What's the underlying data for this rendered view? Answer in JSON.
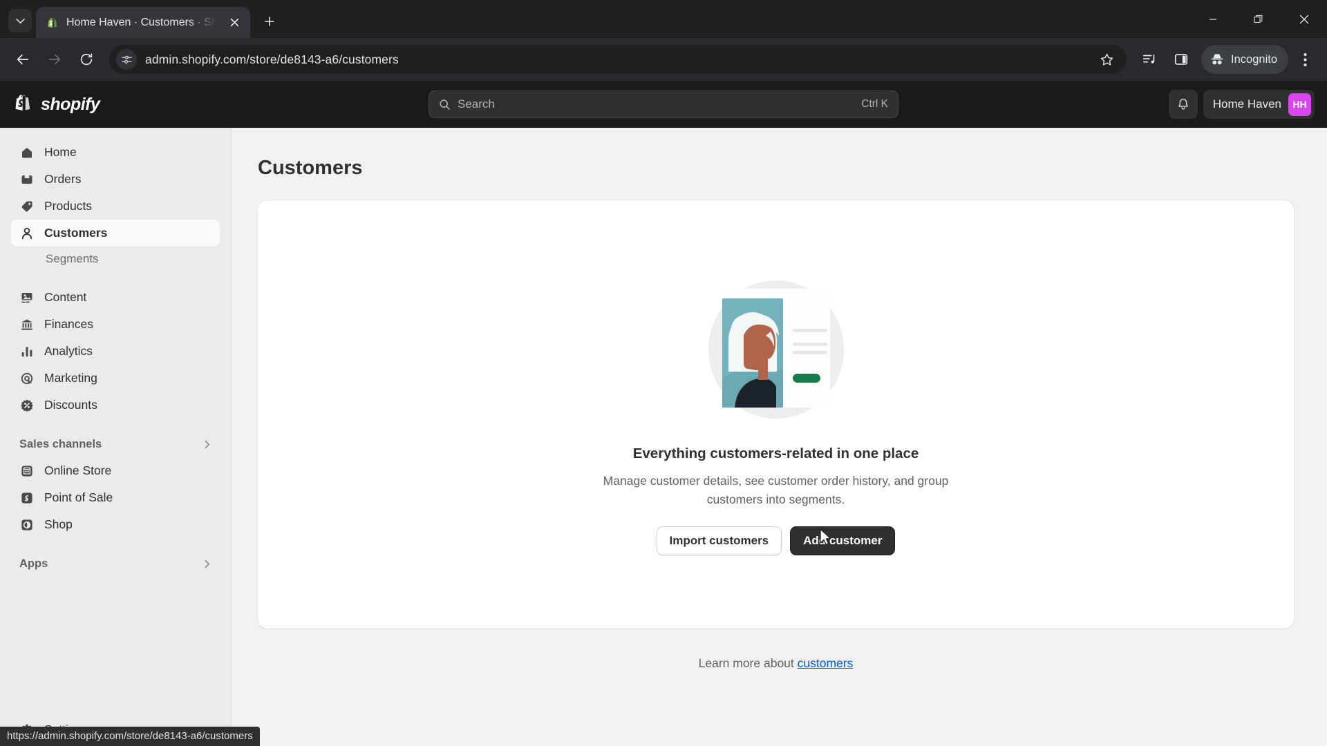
{
  "browser": {
    "tab": {
      "title": "Home Haven · Customers · Sho",
      "favicon": "shopify-favicon"
    },
    "new_tab_label": "+",
    "url": "admin.shopify.com/store/de8143-a6/customers",
    "toolbar_icons": [
      "back-icon",
      "forward-icon",
      "reload-icon",
      "site-settings-icon",
      "bookmark-star-icon",
      "media-control-icon",
      "side-panel-icon",
      "browser-menu-icon"
    ],
    "profile_label": "Incognito",
    "window_controls": [
      "minimize",
      "restore",
      "close"
    ],
    "status_url": "https://admin.shopify.com/store/de8143-a6/customers"
  },
  "topbar": {
    "brand": "shopify",
    "search": {
      "placeholder": "Search",
      "shortcut": "Ctrl K"
    },
    "notifications_icon": "bell-icon",
    "store_name": "Home Haven",
    "store_initials": "HH",
    "avatar_color": "#d946ef"
  },
  "sidebar": {
    "items": [
      {
        "label": "Home",
        "icon": "home-icon",
        "active": false
      },
      {
        "label": "Orders",
        "icon": "orders-inbox-icon",
        "active": false
      },
      {
        "label": "Products",
        "icon": "products-tag-icon",
        "active": false
      },
      {
        "label": "Customers",
        "icon": "customers-person-icon",
        "active": true
      }
    ],
    "sub_items": [
      {
        "label": "Segments"
      }
    ],
    "items2": [
      {
        "label": "Content",
        "icon": "content-image-icon"
      },
      {
        "label": "Finances",
        "icon": "finances-bank-icon"
      },
      {
        "label": "Analytics",
        "icon": "analytics-bars-icon"
      },
      {
        "label": "Marketing",
        "icon": "marketing-target-icon"
      },
      {
        "label": "Discounts",
        "icon": "discounts-percent-icon"
      }
    ],
    "sales_channels": {
      "label": "Sales channels",
      "chevron": "chevron-right-icon"
    },
    "channels": [
      {
        "label": "Online Store",
        "icon": "online-store-icon"
      },
      {
        "label": "Point of Sale",
        "icon": "point-of-sale-icon"
      },
      {
        "label": "Shop",
        "icon": "shop-icon"
      }
    ],
    "apps": {
      "label": "Apps",
      "chevron": "chevron-right-icon"
    },
    "settings": {
      "label": "Settings",
      "icon": "gear-icon"
    }
  },
  "main": {
    "page_title": "Customers",
    "empty_state": {
      "illustration": "customer-profile-card-illustration",
      "title": "Everything customers-related in one place",
      "subtitle": "Manage customer details, see customer order history, and group customers into segments.",
      "secondary_button": "Import customers",
      "primary_button": "Add customer"
    },
    "learn_more": {
      "prefix": "Learn more about ",
      "link": "customers"
    }
  },
  "colors": {
    "accent_link": "#005bd3",
    "primary_button_bg": "#303030",
    "avatar": "#d946ef",
    "illustration_teal": "#74b3bd",
    "illustration_green": "#177c4b",
    "illustration_skin": "#b1654a"
  }
}
